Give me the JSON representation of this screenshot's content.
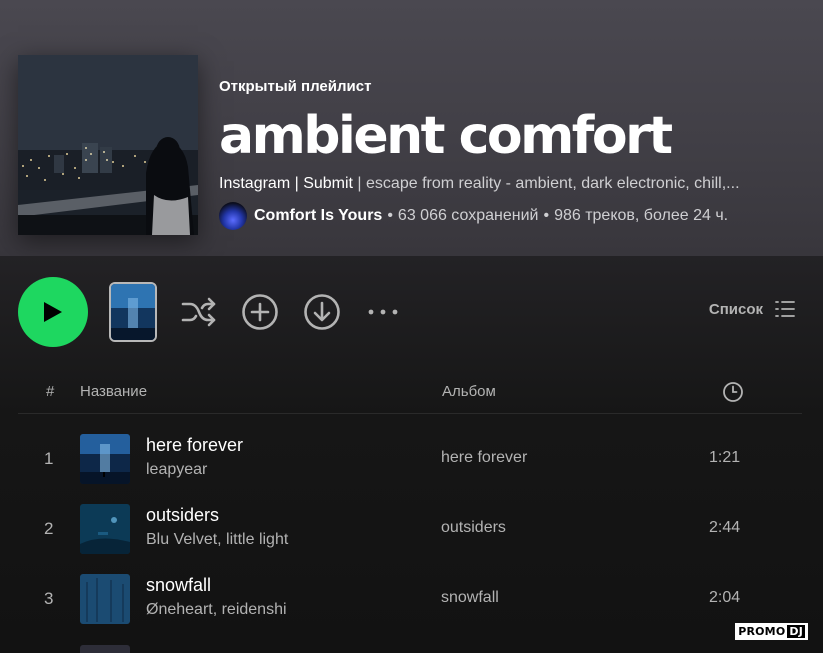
{
  "playlist": {
    "type_label": "Открытый плейлист",
    "title": "ambient comfort",
    "description_link": "Instagram | Submit",
    "description_rest": " | escape from reality - ambient, dark electronic, chill,...",
    "owner": "Comfort Is Yours",
    "saves": "63 066 сохранений",
    "track_info": "986 треков, более 24 ч.",
    "separator": "•"
  },
  "controls": {
    "view_mode_label": "Список"
  },
  "columns": {
    "number": "#",
    "title": "Название",
    "album": "Альбом"
  },
  "tracks": [
    {
      "number": "1",
      "name": "here forever",
      "artist": "leapyear",
      "album": "here forever",
      "duration": "1:21"
    },
    {
      "number": "2",
      "name": "outsiders",
      "artist": "Blu Velvet, little light",
      "album": "outsiders",
      "duration": "2:44"
    },
    {
      "number": "3",
      "name": "snowfall",
      "artist": "Øneheart, reidenshi",
      "album": "snowfall",
      "duration": "2:04"
    }
  ],
  "watermark": {
    "part1": "PROMO",
    "part2": "DJ"
  },
  "icons": [
    "play-icon",
    "shuffle-icon",
    "add-circle-icon",
    "download-icon",
    "more-icon",
    "list-view-icon",
    "clock-icon"
  ],
  "colors": {
    "accent": "#1ed760",
    "header_bg": "#48464e",
    "body_bg": "#121212",
    "secondary_text": "#b3b3b3"
  }
}
